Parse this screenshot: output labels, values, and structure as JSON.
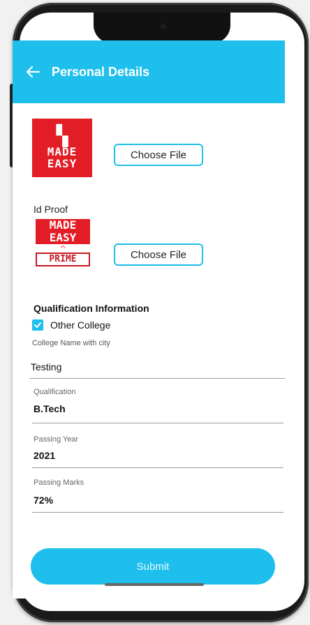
{
  "header": {
    "title": "Personal Details",
    "back_icon": "arrow-left-icon"
  },
  "uploads": {
    "logo1": {
      "line1": "MADE",
      "line2": "EASY"
    },
    "choose_file_1": "Choose File",
    "id_proof_label": "Id Proof",
    "logo2": {
      "line1": "MADE",
      "line2": "EASY",
      "line3": "PRIME"
    },
    "choose_file_2": "Choose File"
  },
  "qualification": {
    "heading": "Qualification Information",
    "checkbox_label": "Other College",
    "checkbox_checked": true,
    "college_label": "College Name with city",
    "college_value": "Testing",
    "fields": [
      {
        "label": "Qualification",
        "value": "B.Tech"
      },
      {
        "label": "Passing Year",
        "value": "2021"
      },
      {
        "label": "Passing Marks",
        "value": "72%"
      }
    ]
  },
  "submit_label": "Submit",
  "colors": {
    "accent": "#1ebfec",
    "brand_red": "#e21d25"
  }
}
